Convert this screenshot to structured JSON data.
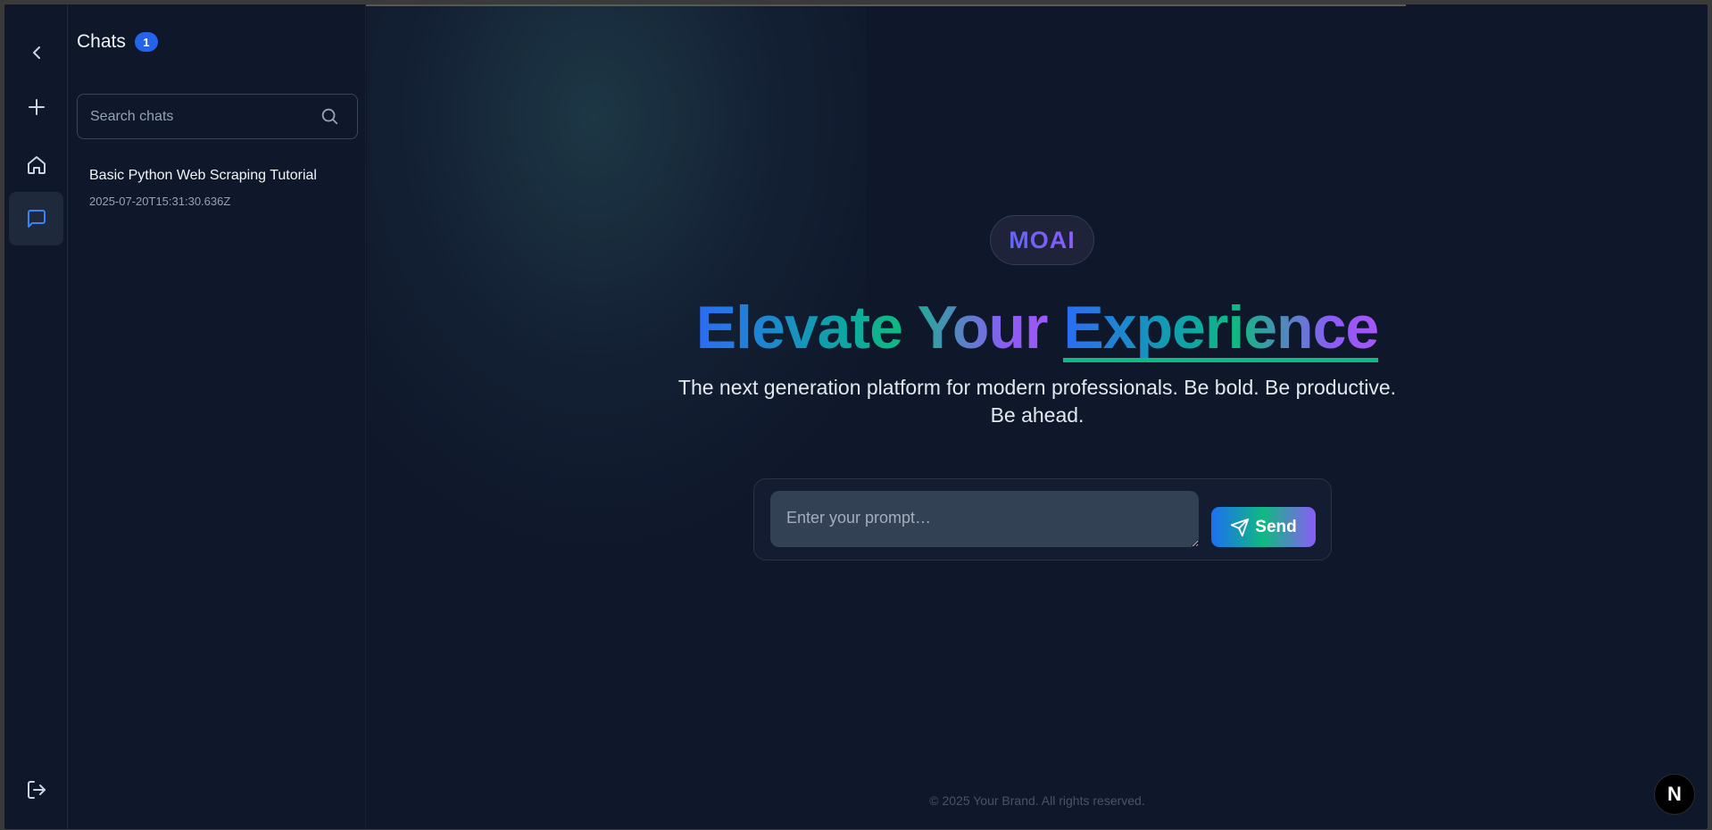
{
  "rail": {
    "items": [
      {
        "name": "collapse",
        "icon": "chevron-left-icon"
      },
      {
        "name": "new-chat",
        "icon": "plus-icon"
      },
      {
        "name": "home",
        "icon": "home-icon"
      },
      {
        "name": "chats",
        "icon": "message-square-icon",
        "active": true
      },
      {
        "name": "logout",
        "icon": "log-out-icon"
      }
    ]
  },
  "chats": {
    "title": "Chats",
    "count": "1",
    "search_placeholder": "Search chats",
    "items": [
      {
        "title": "Basic Python Web Scraping Tutorial",
        "timestamp": "2025-07-20T15:31:30.636Z"
      }
    ]
  },
  "main": {
    "brand": "MOAI",
    "headline_part1": "Elevate Your ",
    "headline_part2": "Experience",
    "subtitle": "The next generation platform for modern professionals. Be bold. Be productive. Be ahead.",
    "prompt_placeholder": "Enter your prompt…",
    "send_label": "Send",
    "footer": "© 2025 Your Brand. All rights reserved."
  },
  "overlay": {
    "next_badge": "N"
  },
  "colors": {
    "background": "#0f172a",
    "accent_blue": "#2563eb",
    "accent_green": "#10b981",
    "accent_purple": "#8b5cf6"
  }
}
